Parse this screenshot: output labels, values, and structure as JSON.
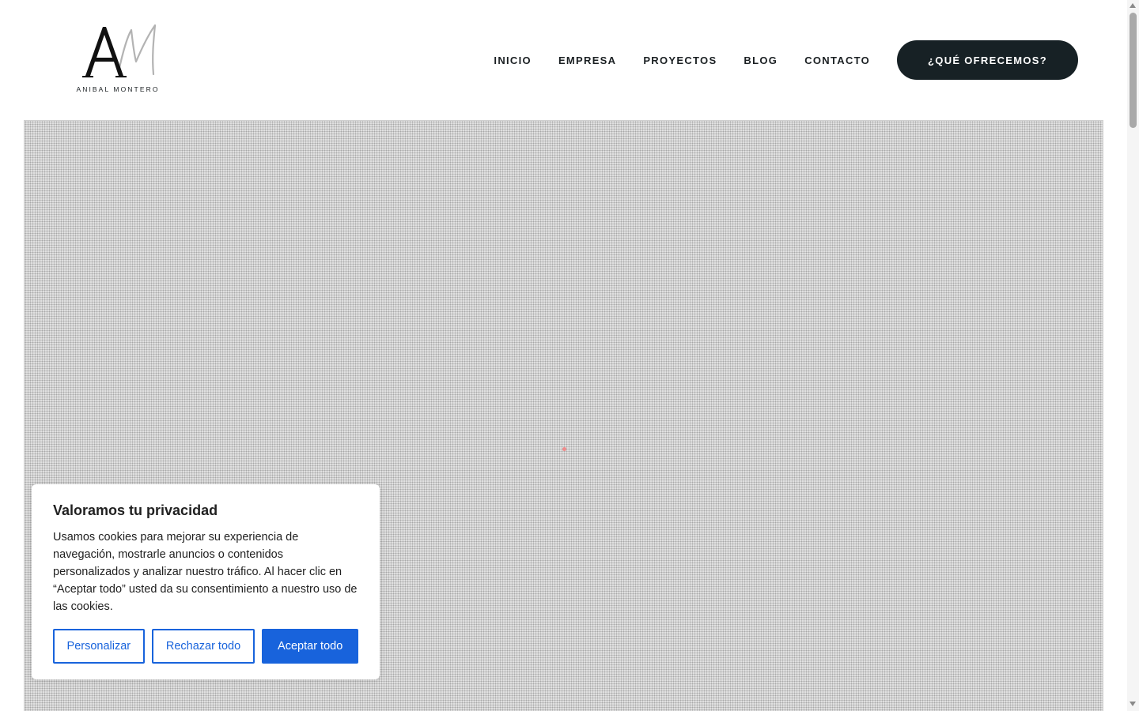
{
  "logo": {
    "brand_text": "ANIBAL MONTERO",
    "monogram_text": "AM"
  },
  "nav": {
    "items": [
      "INICIO",
      "EMPRESA",
      "PROYECTOS",
      "BLOG",
      "CONTACTO"
    ],
    "cta_label": "¿QUÉ OFRECEMOS?"
  },
  "cookie": {
    "title": "Valoramos tu privacidad",
    "text": "Usamos cookies para mejorar su experiencia de navegación, mostrarle anuncios o contenidos personalizados y analizar nuestro tráfico. Al hacer clic en “Aceptar todo” usted da su consentimiento a nuestro uso de las cookies.",
    "customize_label": "Personalizar",
    "reject_label": "Rechazar todo",
    "accept_label": "Aceptar todo"
  },
  "colors": {
    "cta_background": "#172125",
    "cookie_accent": "#1863dc"
  }
}
